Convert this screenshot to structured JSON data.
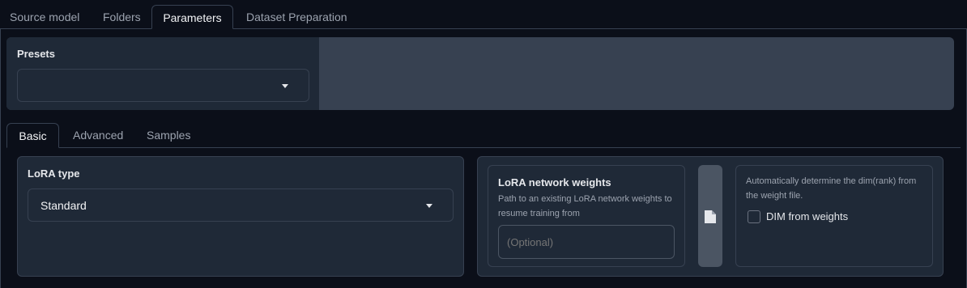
{
  "top_tabs": [
    {
      "label": "Source model",
      "active": false
    },
    {
      "label": "Folders",
      "active": false
    },
    {
      "label": "Parameters",
      "active": true
    },
    {
      "label": "Dataset Preparation",
      "active": false
    }
  ],
  "presets": {
    "label": "Presets",
    "value": ""
  },
  "sub_tabs": [
    {
      "label": "Basic",
      "active": true
    },
    {
      "label": "Advanced",
      "active": false
    },
    {
      "label": "Samples",
      "active": false
    }
  ],
  "lora_type": {
    "label": "LoRA type",
    "value": "Standard"
  },
  "network_weights": {
    "label": "LoRA network weights",
    "description": "Path to an existing LoRA network weights to resume training from",
    "placeholder": "(Optional)",
    "value": ""
  },
  "dim_from_weights": {
    "description": "Automatically determine the dim(rank) from the weight file.",
    "label": "DIM from weights",
    "checked": false
  },
  "icons": {
    "dropdown_caret": "chevron-down-icon",
    "file_button": "file-icon"
  }
}
